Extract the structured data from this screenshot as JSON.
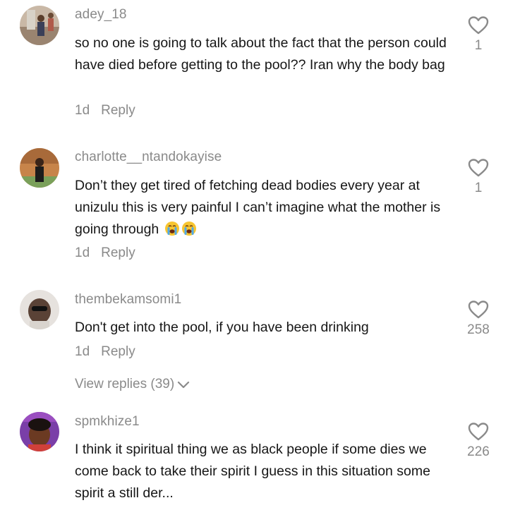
{
  "comments": [
    {
      "username": "adey_18",
      "text": "so no one is going to talk about the fact that the person could have died before getting to the pool?? Iran why the body bag",
      "time": "1d",
      "reply_label": "Reply",
      "likes": "1"
    },
    {
      "username": "charlotte__ntandokayise",
      "text": "Don’t they get tired of fetching dead bodies every year at unizulu this is very painful I can’t imagine what the mother is going through",
      "emoji": "crying-face-emoji",
      "time": "1d",
      "reply_label": "Reply",
      "likes": "1"
    },
    {
      "username": "thembekamsomi1",
      "text": "Don't get into the pool, if you have been drinking",
      "time": "1d",
      "reply_label": "Reply",
      "likes": "258",
      "view_replies": "View replies (39)"
    },
    {
      "username": "spmkhize1",
      "text": "I think it spiritual thing we as black people if some dies we come back to take their spirit I guess in this situation some spirit a still der...",
      "likes": "226"
    }
  ],
  "icons": {
    "like": "heart-outline-icon",
    "expand": "chevron-down-icon"
  },
  "colors": {
    "secondary_text": "#8a8a8a",
    "primary_text": "#161616"
  }
}
